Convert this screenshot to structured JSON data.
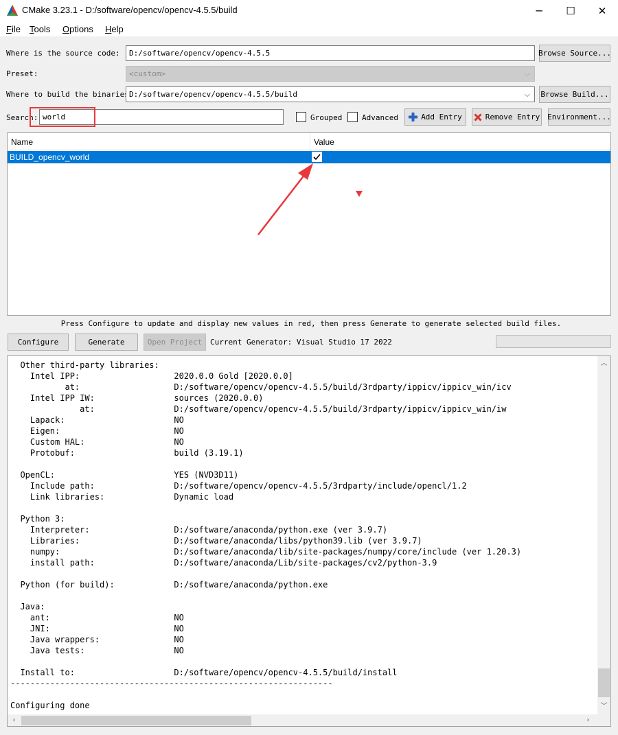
{
  "window": {
    "title": "CMake 3.23.1 - D:/software/opencv/opencv-4.5.5/build",
    "minimize_glyph": "─",
    "maximize_glyph": "☐",
    "close_glyph": "✕"
  },
  "menu": [
    {
      "mnemonic": "F",
      "rest": "ile"
    },
    {
      "mnemonic": "T",
      "rest": "ools"
    },
    {
      "mnemonic": "O",
      "rest": "ptions"
    },
    {
      "mnemonic": "H",
      "rest": "elp"
    }
  ],
  "source": {
    "label": "Where is the source code:",
    "value": "D:/software/opencv/opencv-4.5.5",
    "button": "Browse Source..."
  },
  "preset": {
    "label": "Preset:",
    "value": "<custom>"
  },
  "build": {
    "label": "Where to build the binaries:",
    "value": "D:/software/opencv/opencv-4.5.5/build",
    "button": "Browse Build..."
  },
  "search": {
    "label": "Search:",
    "value": "world"
  },
  "options": {
    "grouped": "Grouped",
    "advanced": "Advanced",
    "add_entry": "Add Entry",
    "remove_entry": "Remove Entry",
    "environment": "Environment..."
  },
  "table": {
    "columns": [
      "Name",
      "Value"
    ],
    "rows": [
      {
        "name": "BUILD_opencv_world",
        "checked": true
      }
    ]
  },
  "message": "Press Configure to update and display new values in red, then press Generate to generate selected build files.",
  "actions": {
    "configure": "Configure",
    "generate": "Generate",
    "open_project": "Open Project",
    "generator": "Current Generator: Visual Studio 17 2022"
  },
  "output": {
    "text": "  Other third-party libraries:\n    Intel IPP:                   2020.0.0 Gold [2020.0.0]\n           at:                   D:/software/opencv/opencv-4.5.5/build/3rdparty/ippicv/ippicv_win/icv\n    Intel IPP IW:                sources (2020.0.0)\n              at:                D:/software/opencv/opencv-4.5.5/build/3rdparty/ippicv/ippicv_win/iw\n    Lapack:                      NO\n    Eigen:                       NO\n    Custom HAL:                  NO\n    Protobuf:                    build (3.19.1)\n\n  OpenCL:                        YES (NVD3D11)\n    Include path:                D:/software/opencv/opencv-4.5.5/3rdparty/include/opencl/1.2\n    Link libraries:              Dynamic load\n\n  Python 3:\n    Interpreter:                 D:/software/anaconda/python.exe (ver 3.9.7)\n    Libraries:                   D:/software/anaconda/libs/python39.lib (ver 3.9.7)\n    numpy:                       D:/software/anaconda/lib/site-packages/numpy/core/include (ver 1.20.3)\n    install path:                D:/software/anaconda/Lib/site-packages/cv2/python-3.9\n\n  Python (for build):            D:/software/anaconda/python.exe\n\n  Java:\n    ant:                         NO\n    JNI:                         NO\n    Java wrappers:               NO\n    Java tests:                  NO\n\n  Install to:                    D:/software/opencv/opencv-4.5.5/build/install\n-----------------------------------------------------------------\n\nConfiguring done"
  },
  "icons": {
    "app": "cmake-triangle-icon",
    "add": "plus-icon",
    "remove": "x-icon"
  },
  "colors": {
    "selection": "#0078d7",
    "annotation_red": "#e8383b",
    "panel": "#f0f0f0"
  }
}
